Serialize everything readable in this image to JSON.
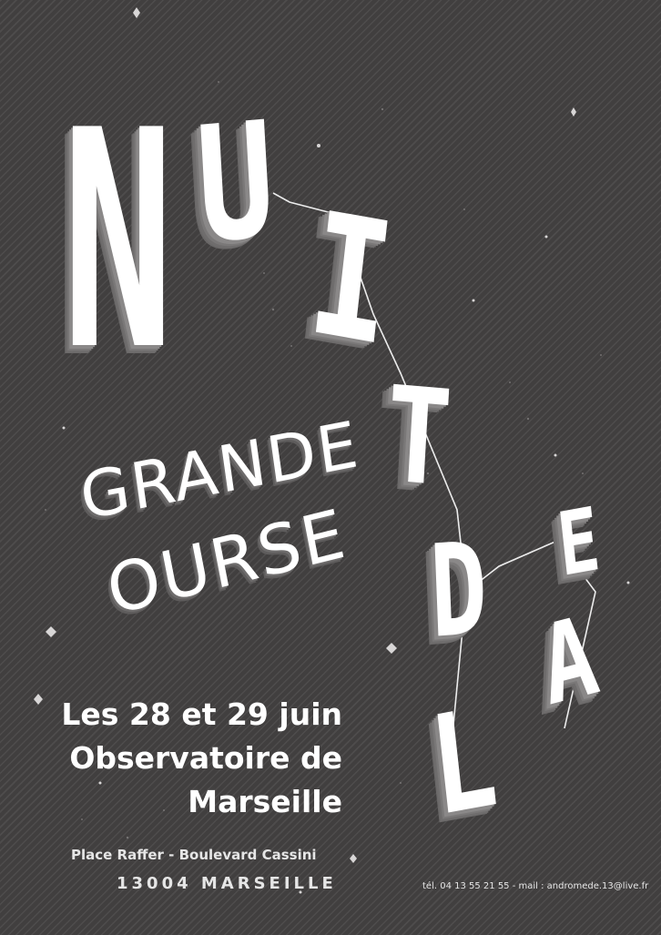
{
  "poster": {
    "big_letters": {
      "n": "N",
      "u": "U",
      "i1": "I",
      "t": "T",
      "d": "D",
      "e": "E",
      "l": "L",
      "a": "A"
    },
    "title": {
      "line1": "GRANDE",
      "line2": "OURSE"
    },
    "info": {
      "dates": "Les 28 et 29 juin",
      "venue_line1": "Observatoire de",
      "venue_line2": "Marseille"
    },
    "address": {
      "street": "Place Raffer - Boulevard Cassini",
      "city": "13004 MARSEILLE"
    },
    "contact": "tél. 04 13 55 21 55 - mail : andromede.13@live.fr"
  },
  "colors": {
    "background": "#413f3f",
    "text": "#ffffff",
    "letter_shadow": "#8a8888"
  }
}
